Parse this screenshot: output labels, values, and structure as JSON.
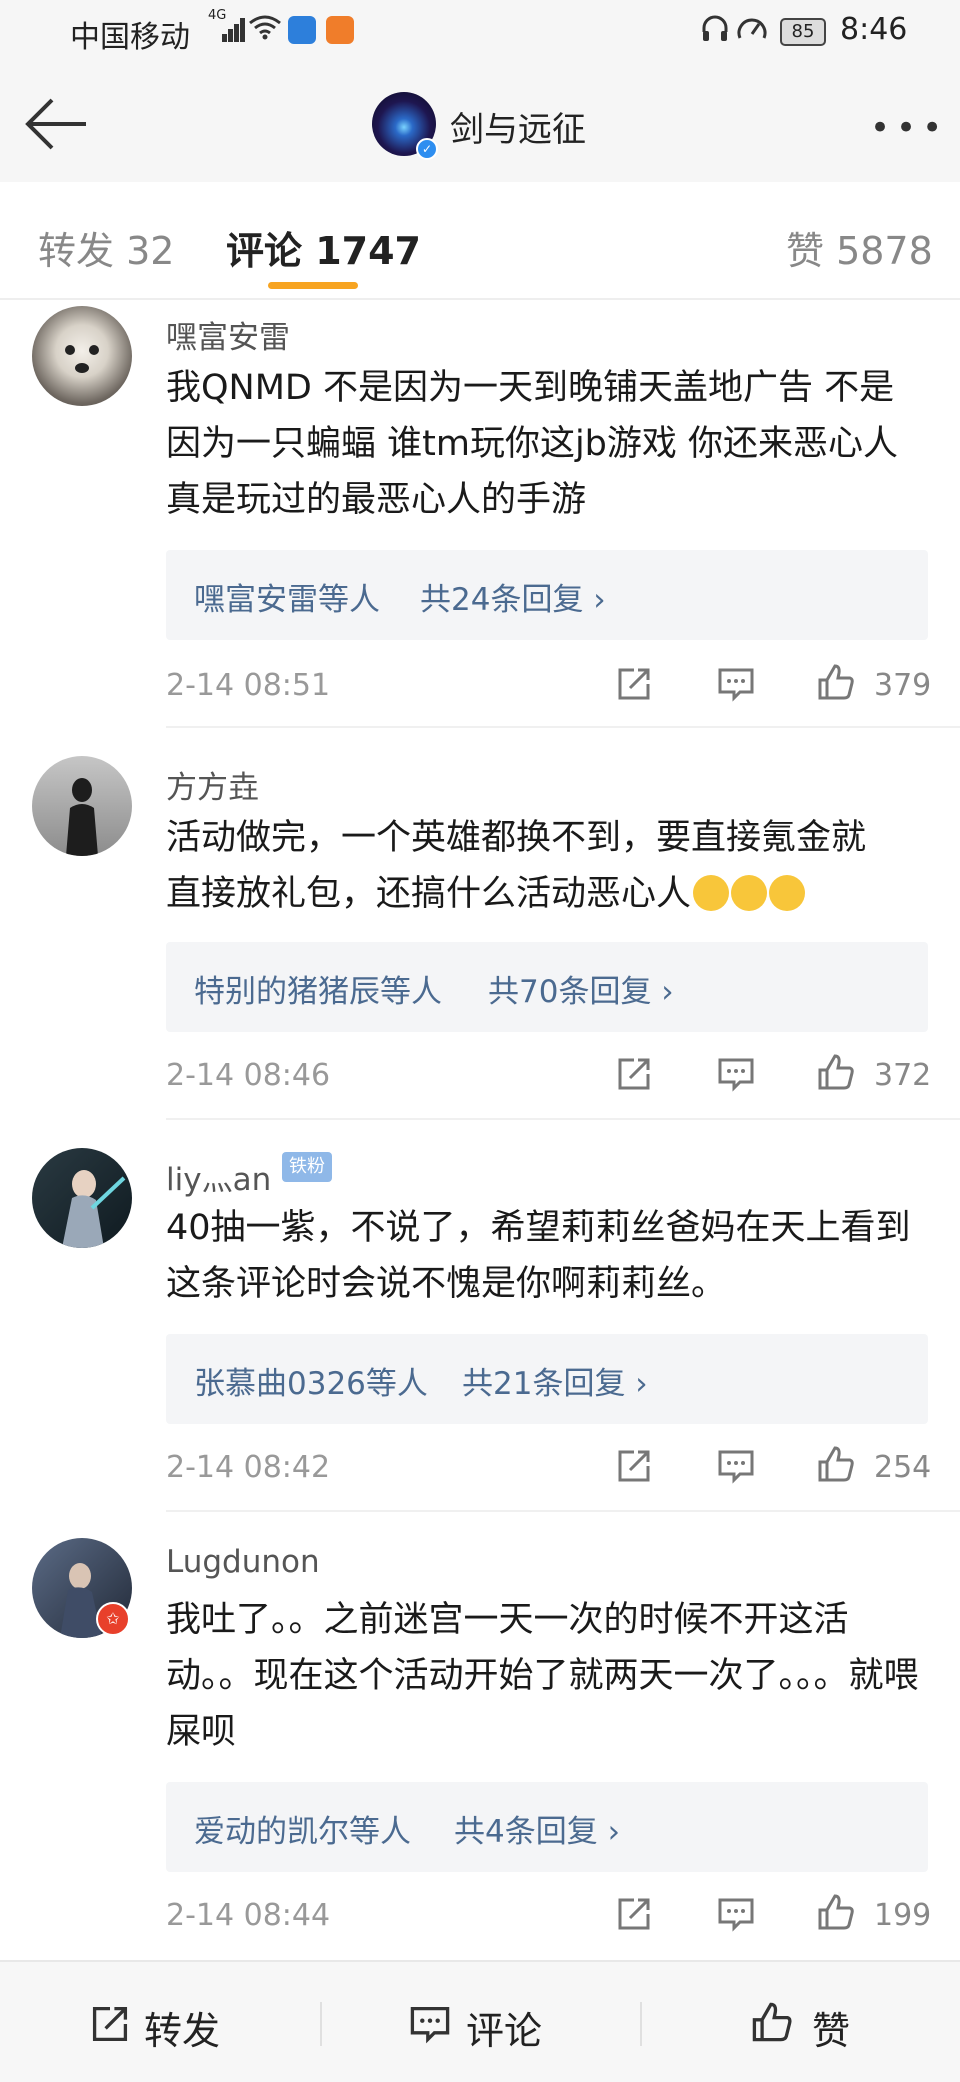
{
  "status_bar": {
    "carrier": "中国移动",
    "network": "4G",
    "battery": "85",
    "time": "8:46"
  },
  "header": {
    "title": "剑与远征",
    "more": "•••"
  },
  "tabs": [
    {
      "label": "转发 32"
    },
    {
      "label": "评论 1747"
    },
    {
      "label": "赞 5878"
    }
  ],
  "comments": [
    {
      "user": "嘿富安雷",
      "text": "我QNMD  不是因为一天到晚铺天盖地广告  不是因为一只蝙蝠 谁tm玩你这jb游戏  你还来恶心人  真是玩过的最恶心人的手游",
      "reply_names": "嘿富安雷等人",
      "reply_count": "共24条回复 ›",
      "time": "2-14 08:51",
      "likes": "379"
    },
    {
      "user": "方方垚",
      "text": "活动做完，一个英雄都换不到，要直接氪金就直接放礼包，还搞什么活动恶心人",
      "reply_names": "特别的猪猪辰等人",
      "reply_count": "共70条回复 ›",
      "time": "2-14 08:46",
      "likes": "372"
    },
    {
      "user": "liy灬an",
      "badge": "铁粉",
      "text": "40抽一紫，不说了，希望莉莉丝爸妈在天上看到这条评论时会说不愧是你啊莉莉丝。",
      "reply_names": "张慕曲0326等人",
      "reply_count": "共21条回复 ›",
      "time": "2-14 08:42",
      "likes": "254"
    },
    {
      "user": "Lugdunon",
      "text": "我吐了。。之前迷宫一天一次的时候不开这活动。。现在这个活动开始了就两天一次了。。。就喂屎呗",
      "reply_names": "爱动的凯尔等人",
      "reply_count": "共4条回复 ›",
      "time": "2-14 08:44",
      "likes": "199"
    }
  ],
  "bottom_bar": {
    "repost": "转发",
    "comment": "评论",
    "like": "赞"
  },
  "colors": {
    "accent": "#f7a421",
    "link": "#4b6a90"
  }
}
